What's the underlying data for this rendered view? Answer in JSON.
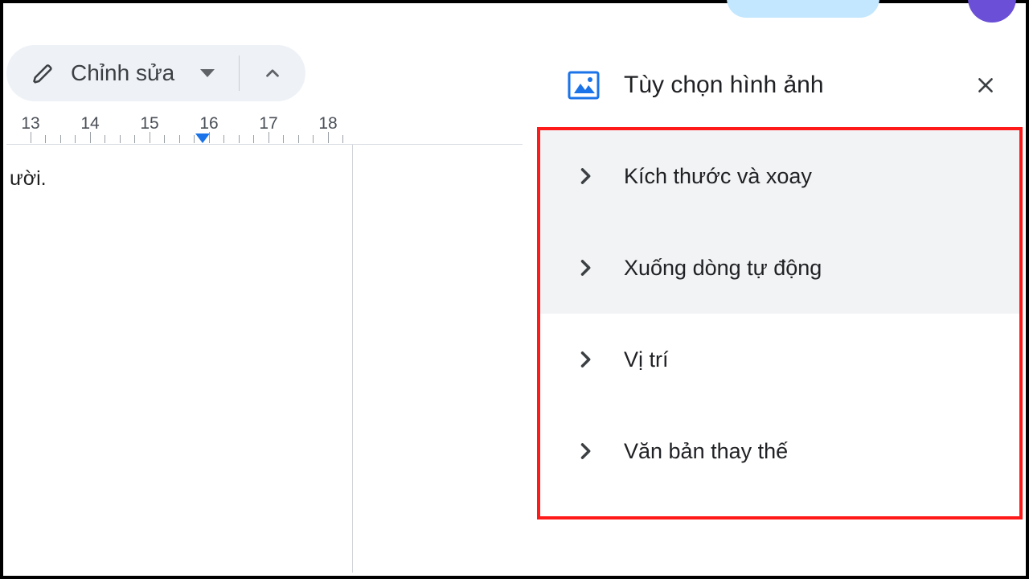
{
  "toolbar": {
    "edit_label": "Chỉnh sửa"
  },
  "ruler": {
    "numbers": [
      "13",
      "14",
      "15",
      "16",
      "17",
      "18"
    ]
  },
  "document": {
    "visible_text": "ười."
  },
  "sidebar": {
    "title": "Tùy chọn hình ảnh",
    "options": [
      {
        "label": "Kích thước và xoay"
      },
      {
        "label": "Xuống dòng tự động"
      },
      {
        "label": "Vị trí"
      },
      {
        "label": "Văn bản thay thế"
      }
    ]
  }
}
